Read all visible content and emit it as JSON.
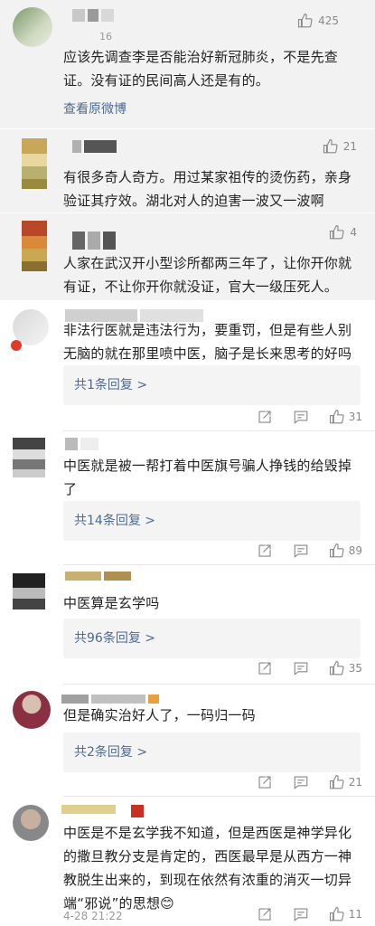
{
  "comments": [
    {
      "likes": "425",
      "name_suffix": "16",
      "text": "应该先调查李是否能治好新冠肺炎，不是先查证。没有证的民间高人还是有的。",
      "link": "查看原微博"
    },
    {
      "likes": "21",
      "text": "有很多奇人奇方。用过某家祖传的烫伤药，亲身验证其疗效。湖北对人的迫害一波又一波啊"
    },
    {
      "likes": "4",
      "text": "人家在武汉开小型诊所都两三年了，让你开你就有证，不让你开你就没证，官大一级压死人。"
    },
    {
      "text": "非法行医就是违法行为，要重罚，但是有些人别无脑的就在那里喷中医，脑子是长来思考的好吗",
      "reply": "共1条回复 >",
      "likes": "31"
    },
    {
      "text": "中医就是被一帮打着中医旗号骗人挣钱的给毁掉了",
      "reply": "共14条回复 >",
      "likes": "89"
    },
    {
      "text": "中医算是玄学吗",
      "reply": "共96条回复 >",
      "likes": "35"
    },
    {
      "text": "但是确实治好人了，一码归一码",
      "reply": "共2条回复 >",
      "likes": "21"
    },
    {
      "text": "中医是不是玄学我不知道，但是西医是神学异化的撒旦教分支是肯定的，西医最早是从西方一神教脱生出来的，到现在依然有浓重的消灭一切异端“邪说”的思想😊",
      "time": "4-28 21:22",
      "likes": "11"
    }
  ],
  "colors": {
    "link": "#4f6b90",
    "grey_bg": "#f2f2f2",
    "reply_bg": "#f4f4f4"
  },
  "icons": [
    "thumbs-up-icon",
    "share-icon",
    "comment-icon"
  ]
}
